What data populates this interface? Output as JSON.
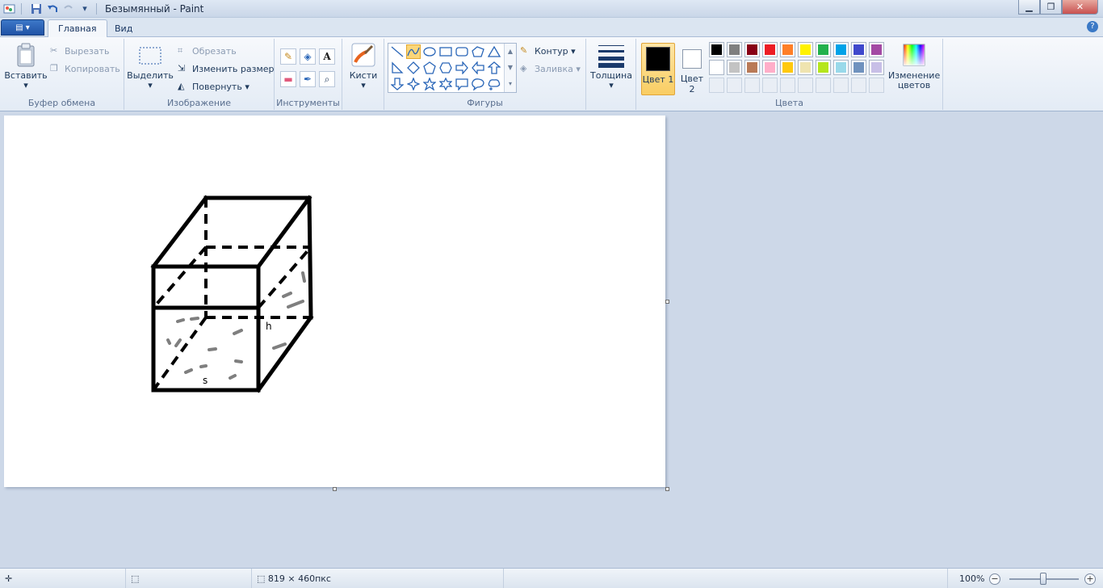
{
  "window": {
    "title": "Безымянный - Paint"
  },
  "tabs": {
    "home": "Главная",
    "view": "Вид"
  },
  "clipboard": {
    "paste": "Вставить",
    "cut": "Вырезать",
    "copy": "Копировать",
    "label": "Буфер обмена"
  },
  "image": {
    "select": "Выделить",
    "crop": "Обрезать",
    "resize": "Изменить размер",
    "rotate": "Повернуть",
    "label": "Изображение"
  },
  "tools": {
    "label": "Инструменты",
    "text_glyph": "A"
  },
  "brushes": {
    "label": "Кисти"
  },
  "shapes": {
    "outline": "Контур",
    "fill": "Заливка",
    "label": "Фигуры"
  },
  "size": {
    "label": "Толщина"
  },
  "colors": {
    "color1_label": "Цвет 1",
    "color2_label": "Цвет 2",
    "edit_label": "Изменение цветов",
    "label": "Цвета",
    "palette_row1": [
      "#000000",
      "#7f7f7f",
      "#880015",
      "#ed1c24",
      "#ff7f27",
      "#fff200",
      "#22b14c",
      "#00a2e8",
      "#3f48cc",
      "#a349a4"
    ],
    "palette_row2": [
      "#ffffff",
      "#c3c3c3",
      "#b97a57",
      "#ffaec9",
      "#ffc90e",
      "#efe4b0",
      "#b5e61d",
      "#99d9ea",
      "#7092be",
      "#c8bfe7"
    ]
  },
  "drawing": {
    "label_h": "h",
    "label_s": "s"
  },
  "status": {
    "canvas_size": "819 × 460пкс",
    "zoom": "100%"
  }
}
